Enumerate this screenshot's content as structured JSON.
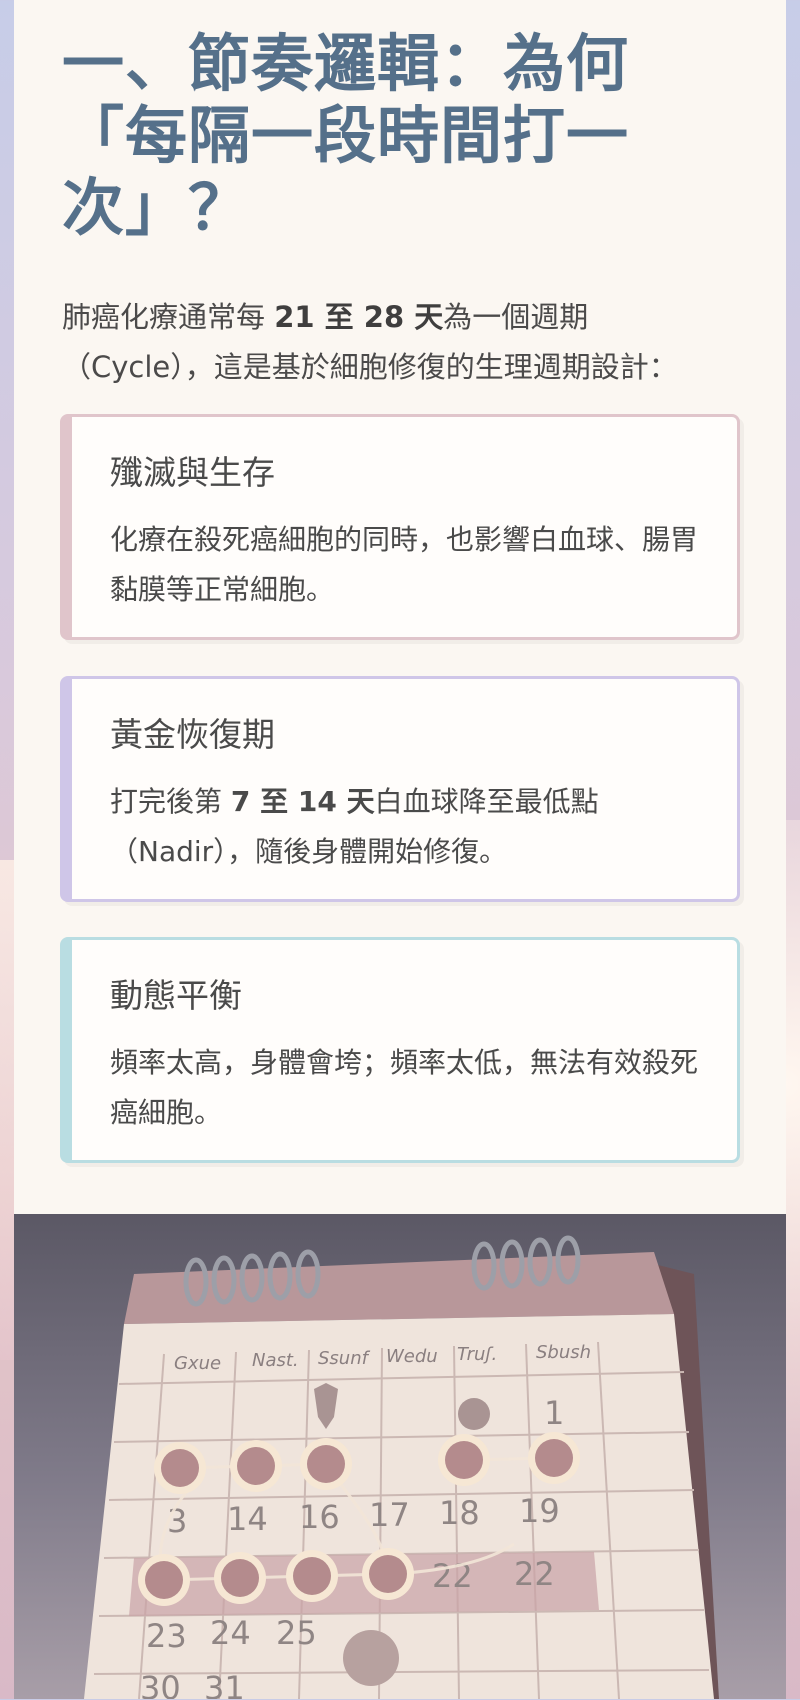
{
  "section": {
    "title": "一、節奏邏輯：為何「每隔一段時間打一次」？",
    "intro_pre": "肺癌化療通常每 ",
    "intro_bold": "21 至 28 天",
    "intro_post": "為一個週期（Cycle），這是基於細胞修復的生理週期設計："
  },
  "cards": [
    {
      "title": "殲滅與生存",
      "body": "化療在殺死癌細胞的同時，也影響白血球、腸胃黏膜等正常細胞。"
    },
    {
      "title": "黃金恢復期",
      "body_pre": "打完後第 ",
      "body_bold": "7 至 14 天",
      "body_post": "白血球降至最低點（Nadir），隨後身體開始修復。"
    },
    {
      "title": "動態平衡",
      "body": "頻率太高，身體會垮；頻率太低，無法有效殺死癌細胞。"
    }
  ],
  "calendar": {
    "weekdays": [
      "Gxue",
      "Nast.",
      "Ssunf",
      "Wedu",
      "Truʃ.",
      "Sbush"
    ],
    "numbers": [
      "1",
      "3",
      "14",
      "16",
      "17",
      "18",
      "19",
      "22",
      "22",
      "23",
      "24",
      "25",
      "30",
      "31"
    ]
  },
  "colors": {
    "title": "#55708a",
    "card1_border": "#e0c5cb",
    "card2_border": "#cfc6e8",
    "card3_border": "#b9dde2",
    "page_bg": "#fbf7f2"
  }
}
